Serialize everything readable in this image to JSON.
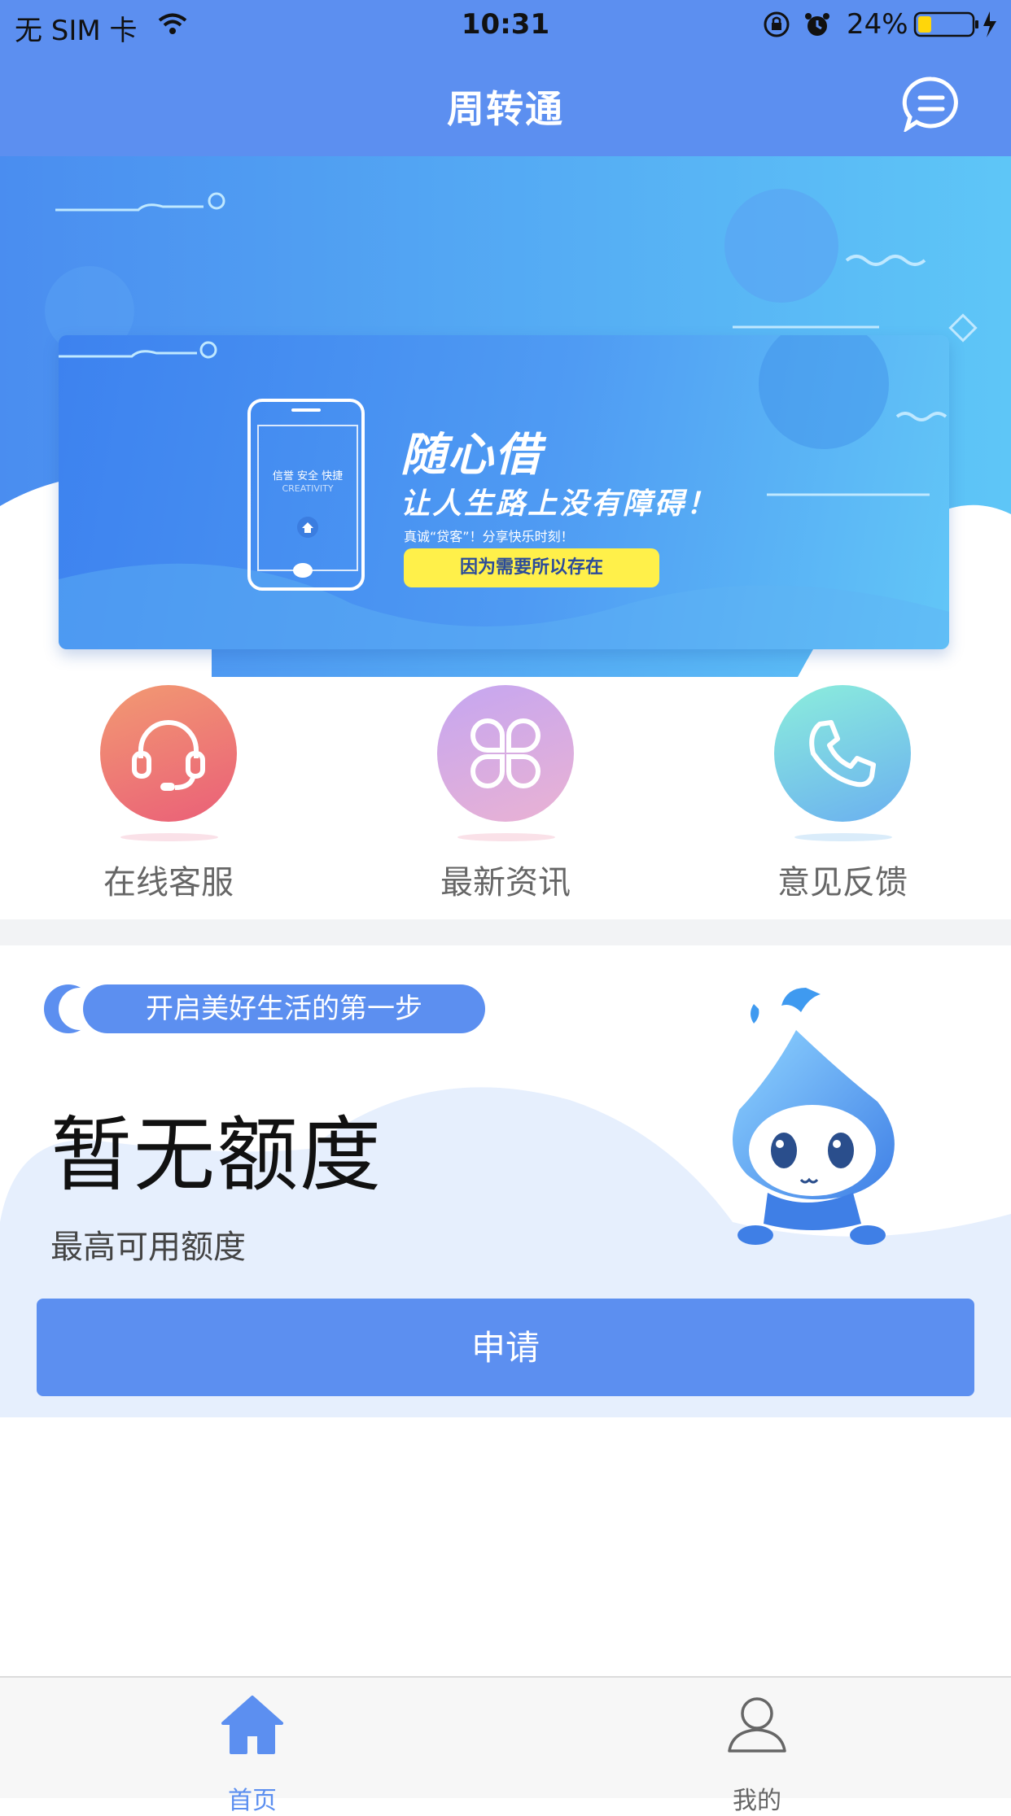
{
  "status_bar": {
    "carrier": "无 SIM 卡",
    "time": "10:31",
    "battery": "24%"
  },
  "header": {
    "title": "周转通"
  },
  "banner": {
    "title": "随心借",
    "subtitle": "让人生路上没有障碍！",
    "tagline": "真诚“贷客”！分享快乐时刻！",
    "pill": "因为需要所以存在",
    "phone_text": "信誉 安全 快捷",
    "phone_subtext": "CREATIVITY"
  },
  "quick_actions": [
    {
      "label": "在线客服",
      "icon": "headset-icon"
    },
    {
      "label": "最新资讯",
      "icon": "clover-icon"
    },
    {
      "label": "意见反馈",
      "icon": "phone-icon"
    }
  ],
  "credit": {
    "slogan": "开启美好生活的第一步",
    "amount": "暂无额度",
    "label": "最高可用额度",
    "apply_label": "申请"
  },
  "tabs": [
    {
      "label": "首页",
      "icon": "home-icon",
      "active": true
    },
    {
      "label": "我的",
      "icon": "user-icon",
      "active": false
    }
  ],
  "colors": {
    "primary": "#5c8ff0",
    "background": "#ffffff",
    "divider": "#f2f3f5",
    "pill_yellow": "#fff04a"
  }
}
